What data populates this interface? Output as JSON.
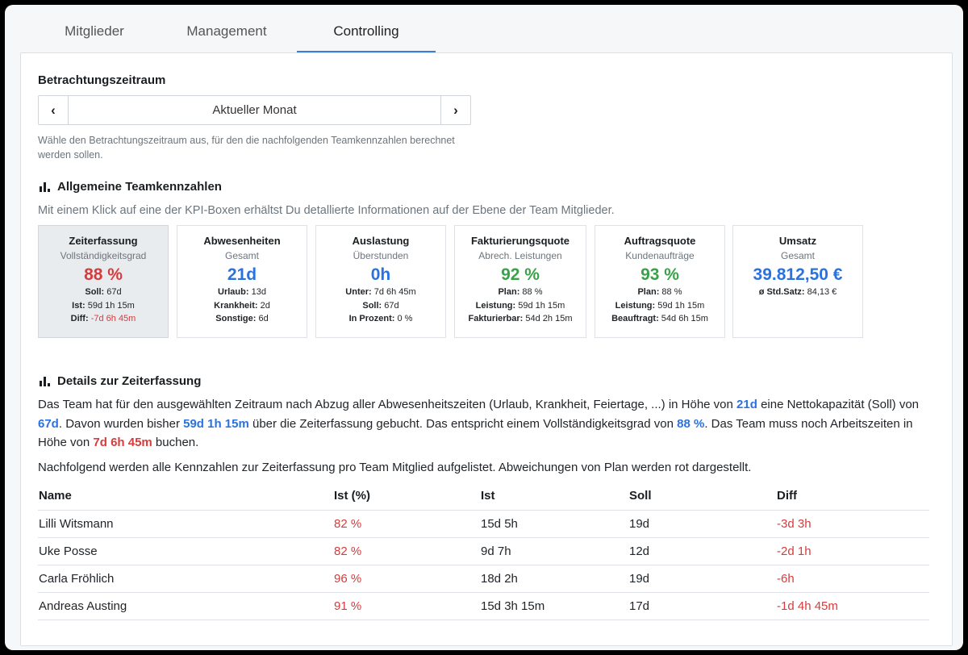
{
  "tabs": [
    {
      "label": "Mitglieder"
    },
    {
      "label": "Management"
    },
    {
      "label": "Controlling"
    }
  ],
  "period": {
    "title": "Betrachtungszeitraum",
    "value": "Aktueller Monat",
    "prev": "‹",
    "next": "›",
    "hint": "Wähle den Betrachtungszeitraum aus, für den die nachfolgenden Teamkennzahlen berechnet werden sollen."
  },
  "general": {
    "title": "Allgemeine Teamkennzahlen",
    "subtitle": "Mit einem Klick auf eine der KPI-Boxen erhältst Du detallierte Informationen auf der Ebene der Team Mitglieder."
  },
  "kpis": {
    "zeit": {
      "title": "Zeiterfassung",
      "sub": "Vollständigkeitsgrad",
      "value": "88 %",
      "l1k": "Soll:",
      "l1v": " 67d",
      "l2k": "Ist:",
      "l2v": " 59d 1h 15m",
      "l3k": "Diff:",
      "l3v": " -7d 6h 45m"
    },
    "abw": {
      "title": "Abwesenheiten",
      "sub": "Gesamt",
      "value": "21d",
      "l1k": "Urlaub:",
      "l1v": " 13d",
      "l2k": "Krankheit:",
      "l2v": " 2d",
      "l3k": "Sonstige:",
      "l3v": " 6d"
    },
    "ausl": {
      "title": "Auslastung",
      "sub": "Überstunden",
      "value": "0h",
      "l1k": "Unter:",
      "l1v": " 7d 6h 45m",
      "l2k": "Soll:",
      "l2v": " 67d",
      "l3k": "In Prozent:",
      "l3v": " 0 %"
    },
    "fakt": {
      "title": "Fakturierungsquote",
      "sub": "Abrech. Leistungen",
      "value": "92 %",
      "l1k": "Plan:",
      "l1v": " 88 %",
      "l2k": "Leistung:",
      "l2v": " 59d 1h 15m",
      "l3k": "Fakturierbar:",
      "l3v": " 54d 2h 15m"
    },
    "auft": {
      "title": "Auftragsquote",
      "sub": "Kundenaufträge",
      "value": "93 %",
      "l1k": "Plan:",
      "l1v": " 88 %",
      "l2k": "Leistung:",
      "l2v": " 59d 1h 15m",
      "l3k": "Beauftragt:",
      "l3v": " 54d 6h 15m"
    },
    "ums": {
      "title": "Umsatz",
      "sub": "Gesamt",
      "value": "39.812,50 €",
      "l1k": "ø Std.Satz:",
      "l1v": " 84,13 €"
    }
  },
  "details": {
    "title": "Details zur Zeiterfassung",
    "p1": {
      "t1": "Das Team hat für den ausgewählten Zeitraum nach Abzug aller Abwesenheitszeiten (Urlaub, Krankheit, Feiertage, ...) in Höhe von ",
      "v1": "21d",
      "t2": " eine Nettokapazität (Soll) von ",
      "v2": "67d",
      "t3": ". Davon wurden bisher ",
      "v3": "59d 1h 15m",
      "t4": " über die Zeiterfassung gebucht. Das entspricht einem Vollständigkeitsgrad von ",
      "v4": "88 %",
      "t5": ". Das Team muss noch Arbeitszeiten in Höhe von ",
      "v5": "7d 6h 45m",
      "t6": " buchen."
    },
    "p2": "Nachfolgend werden alle Kennzahlen zur Zeiterfassung pro Team Mitglied aufgelistet. Abweichungen von Plan werden rot dargestellt."
  },
  "table": {
    "headers": [
      "Name",
      "Ist (%)",
      "Ist",
      "Soll",
      "Diff"
    ],
    "rows": [
      [
        "Lilli Witsmann",
        "82 %",
        "15d 5h",
        "19d",
        "-3d 3h"
      ],
      [
        "Uke Posse",
        "82 %",
        "9d 7h",
        "12d",
        "-2d 1h"
      ],
      [
        "Carla Fröhlich",
        "96 %",
        "18d 2h",
        "19d",
        "-6h"
      ],
      [
        "Andreas Austing",
        "91 %",
        "15d 3h 15m",
        "17d",
        "-1d 4h 45m"
      ]
    ]
  },
  "colors": {
    "accent": "#3b7ddd",
    "red": "#d63c3c",
    "blue": "#2a72e0",
    "green": "#3aa14a"
  },
  "icons": {
    "section": "bar-chart-icon",
    "prev": "chevron-left-icon",
    "next": "chevron-right-icon"
  }
}
